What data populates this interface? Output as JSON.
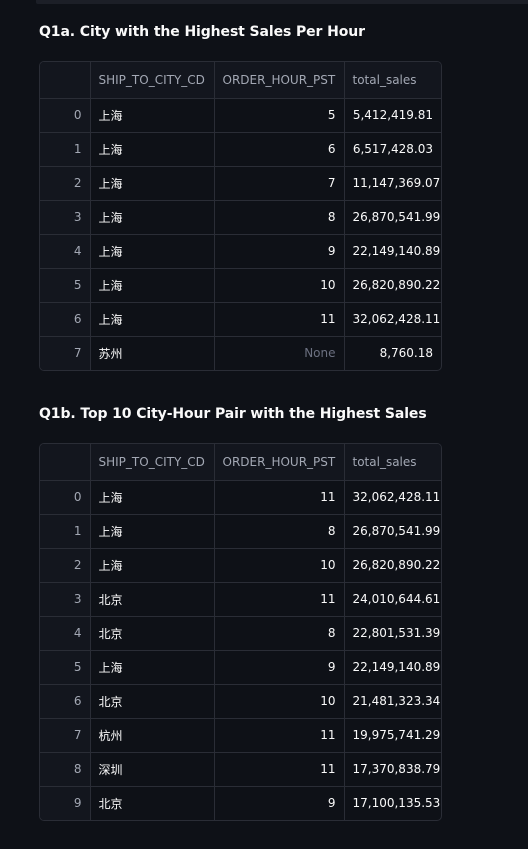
{
  "q1a": {
    "title": "Q1a. City with the Highest Sales Per Hour",
    "columns": [
      "",
      "SHIP_TO_CITY_CD",
      "ORDER_HOUR_PST",
      "total_sales"
    ],
    "rows": [
      {
        "idx": "0",
        "city": "上海",
        "hour": "5",
        "sales": "5,412,419.81"
      },
      {
        "idx": "1",
        "city": "上海",
        "hour": "6",
        "sales": "6,517,428.03"
      },
      {
        "idx": "2",
        "city": "上海",
        "hour": "7",
        "sales": "11,147,369.07"
      },
      {
        "idx": "3",
        "city": "上海",
        "hour": "8",
        "sales": "26,870,541.99"
      },
      {
        "idx": "4",
        "city": "上海",
        "hour": "9",
        "sales": "22,149,140.89"
      },
      {
        "idx": "5",
        "city": "上海",
        "hour": "10",
        "sales": "26,820,890.22"
      },
      {
        "idx": "6",
        "city": "上海",
        "hour": "11",
        "sales": "32,062,428.11"
      },
      {
        "idx": "7",
        "city": "苏州",
        "hour": "None",
        "sales": "8,760.18"
      }
    ]
  },
  "q1b": {
    "title": "Q1b. Top 10 City-Hour Pair with the Highest Sales",
    "columns": [
      "",
      "SHIP_TO_CITY_CD",
      "ORDER_HOUR_PST",
      "total_sales"
    ],
    "rows": [
      {
        "idx": "0",
        "city": "上海",
        "hour": "11",
        "sales": "32,062,428.11"
      },
      {
        "idx": "1",
        "city": "上海",
        "hour": "8",
        "sales": "26,870,541.99"
      },
      {
        "idx": "2",
        "city": "上海",
        "hour": "10",
        "sales": "26,820,890.22"
      },
      {
        "idx": "3",
        "city": "北京",
        "hour": "11",
        "sales": "24,010,644.61"
      },
      {
        "idx": "4",
        "city": "北京",
        "hour": "8",
        "sales": "22,801,531.39"
      },
      {
        "idx": "5",
        "city": "上海",
        "hour": "9",
        "sales": "22,149,140.89"
      },
      {
        "idx": "6",
        "city": "北京",
        "hour": "10",
        "sales": "21,481,323.34"
      },
      {
        "idx": "7",
        "city": "杭州",
        "hour": "11",
        "sales": "19,975,741.29"
      },
      {
        "idx": "8",
        "city": "深圳",
        "hour": "11",
        "sales": "17,370,838.79"
      },
      {
        "idx": "9",
        "city": "北京",
        "hour": "9",
        "sales": "17,100,135.53"
      }
    ]
  }
}
